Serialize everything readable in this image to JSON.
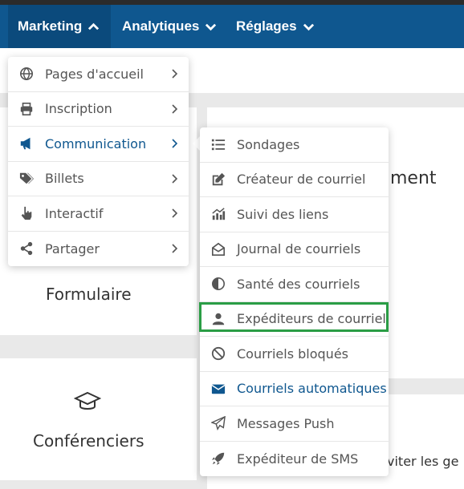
{
  "nav": {
    "items": [
      {
        "label": "Marketing",
        "state": "open"
      },
      {
        "label": "Analytiques",
        "state": "closed"
      },
      {
        "label": "Réglages",
        "state": "closed"
      }
    ]
  },
  "background": {
    "formulaire": "Formulaire",
    "conferenciers": "Conférenciers",
    "partial_right_1": "ment",
    "partial_right_2": "viter les ge"
  },
  "marketing_menu": {
    "items": [
      {
        "label": "Pages d'accueil",
        "icon": "globe-icon"
      },
      {
        "label": "Inscription",
        "icon": "printer-icon"
      },
      {
        "label": "Communication",
        "icon": "megaphone-icon"
      },
      {
        "label": "Billets",
        "icon": "tags-icon"
      },
      {
        "label": "Interactif",
        "icon": "hand-pointer-icon"
      },
      {
        "label": "Partager",
        "icon": "share-icon"
      }
    ]
  },
  "communication_menu": {
    "items": [
      {
        "label": "Sondages",
        "icon": "list-icon"
      },
      {
        "label": "Créateur de courriel",
        "icon": "edit-icon"
      },
      {
        "label": "Suivi des liens",
        "icon": "chart-icon"
      },
      {
        "label": "Journal de courriels",
        "icon": "envelope-open-icon"
      },
      {
        "label": "Santé des courriels",
        "icon": "half-circle-icon"
      },
      {
        "label": "Expéditeurs de courriel",
        "icon": "user-icon"
      },
      {
        "label": "Courriels bloqués",
        "icon": "ban-icon"
      },
      {
        "label": "Courriels automatiques",
        "icon": "envelope-icon"
      },
      {
        "label": "Messages Push",
        "icon": "paper-plane-icon"
      },
      {
        "label": "Expéditeur de SMS",
        "icon": "rocket-icon"
      }
    ]
  },
  "colors": {
    "navbar": "#0f578f",
    "highlight_box": "#2a9d45",
    "active_text": "#0f578f"
  }
}
